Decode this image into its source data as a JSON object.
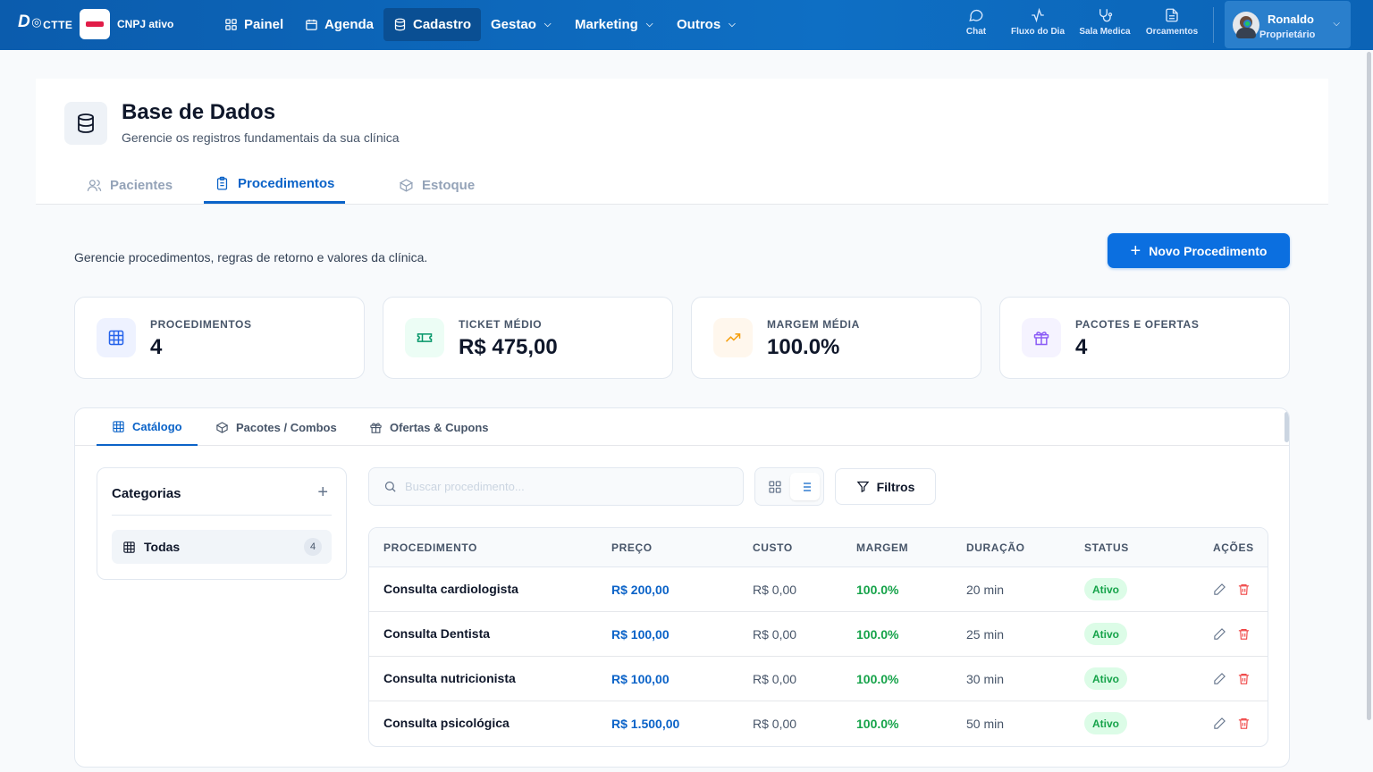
{
  "topnav": {
    "logo_main": "D",
    "logo_rest": "CTTE",
    "cnpj_status": "CNPJ ativo",
    "items": [
      {
        "label": "Painel",
        "icon": "grid-icon",
        "active": false
      },
      {
        "label": "Agenda",
        "icon": "calendar-icon",
        "active": false
      },
      {
        "label": "Cadastro",
        "icon": "database-icon",
        "active": true
      },
      {
        "label": "Gestao",
        "dropdown": true
      },
      {
        "label": "Marketing",
        "dropdown": true
      },
      {
        "label": "Outros",
        "dropdown": true
      }
    ],
    "quick_links": [
      {
        "label": "Chat",
        "icon": "chat-icon"
      },
      {
        "label": "Fluxo do Dia",
        "icon": "activity-icon"
      },
      {
        "label": "Sala Medica",
        "icon": "stethoscope-icon"
      },
      {
        "label": "Orcamentos",
        "icon": "document-icon"
      }
    ],
    "user": {
      "name": "Ronaldo",
      "role": "Proprietário"
    }
  },
  "header": {
    "title": "Base de Dados",
    "subtitle": "Gerencie os registros fundamentais da sua clínica",
    "tabs": [
      {
        "label": "Pacientes",
        "icon": "users-icon"
      },
      {
        "label": "Procedimentos",
        "icon": "clipboard-icon"
      },
      {
        "label": "Estoque",
        "icon": "box-icon"
      }
    ]
  },
  "lead_text": "Gerencie procedimentos, regras de retorno e valores da clínica.",
  "new_button_label": "Novo Procedimento",
  "stats": [
    {
      "label": "PROCEDIMENTOS",
      "value": "4",
      "icon": "table-icon",
      "color": "#2563eb",
      "bg": "#eef2ff"
    },
    {
      "label": "TICKET MÉDIO",
      "value": "R$ 475,00",
      "icon": "ticket-icon",
      "color": "#059669",
      "bg": "#ecfdf5"
    },
    {
      "label": "MARGEM MÉDIA",
      "value": "100.0%",
      "icon": "trending-up-icon",
      "color": "#f59e0b",
      "bg": "#fff7ed"
    },
    {
      "label": "PACOTES E OFERTAS",
      "value": "4",
      "icon": "gift-icon",
      "color": "#8b5cf6",
      "bg": "#f5f3ff"
    }
  ],
  "subtabs": [
    {
      "label": "Catálogo",
      "icon": "table-icon"
    },
    {
      "label": "Pacotes / Combos",
      "icon": "box-icon"
    },
    {
      "label": "Ofertas & Cupons",
      "icon": "gift-icon"
    }
  ],
  "categories": {
    "title": "Categorias",
    "items": [
      {
        "label": "Todas",
        "count": "4"
      }
    ]
  },
  "search": {
    "placeholder": "Buscar procedimento...",
    "value": ""
  },
  "filters_label": "Filtros",
  "table": {
    "headers": [
      "PROCEDIMENTO",
      "PREÇO",
      "CUSTO",
      "MARGEM",
      "DURAÇÃO",
      "STATUS",
      "AÇÕES"
    ],
    "rows": [
      {
        "name": "Consulta cardiologista",
        "price": "R$ 200,00",
        "cost": "R$ 0,00",
        "margin": "100.0%",
        "duration": "20 min",
        "status": "Ativo"
      },
      {
        "name": "Consulta Dentista",
        "price": "R$ 100,00",
        "cost": "R$ 0,00",
        "margin": "100.0%",
        "duration": "25 min",
        "status": "Ativo"
      },
      {
        "name": "Consulta nutricionista",
        "price": "R$ 100,00",
        "cost": "R$ 0,00",
        "margin": "100.0%",
        "duration": "30 min",
        "status": "Ativo"
      },
      {
        "name": "Consulta psicológica",
        "price": "R$ 1.500,00",
        "cost": "R$ 0,00",
        "margin": "100.0%",
        "duration": "50 min",
        "status": "Ativo"
      }
    ]
  },
  "colors": {
    "primary": "#0b63c8",
    "nav": "#0b5cad",
    "success": "#16a34a"
  }
}
